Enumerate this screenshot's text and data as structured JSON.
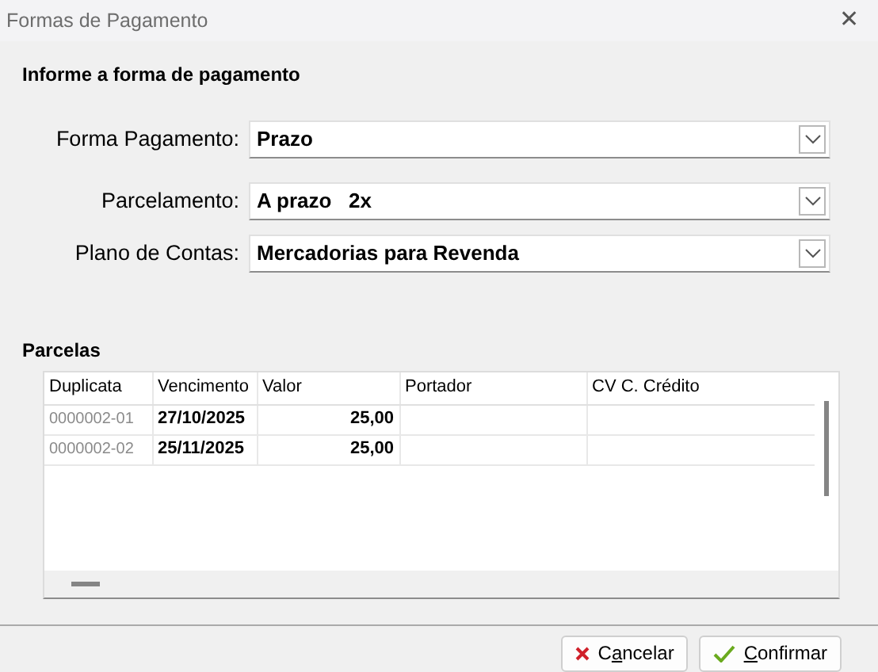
{
  "window": {
    "title": "Formas de Pagamento",
    "close": "✕"
  },
  "heading": "Informe a forma de pagamento",
  "fields": [
    {
      "label": "Forma Pagamento:",
      "value": "Prazo"
    },
    {
      "label": "Parcelamento:",
      "value": "A prazo   2x"
    },
    {
      "label": "Plano de Contas:",
      "value": "Mercadorias para Revenda"
    }
  ],
  "parcelas": {
    "title": "Parcelas",
    "columns": [
      "Duplicata",
      "Vencimento",
      "Valor",
      "Portador",
      "CV C. Crédito"
    ],
    "rows": [
      [
        "0000002-01",
        "27/10/2025",
        "25,00",
        "",
        ""
      ],
      [
        "0000002-02",
        "25/11/2025",
        "25,00",
        "",
        ""
      ]
    ]
  },
  "buttons": [
    {
      "kind": "cancel",
      "before": "C",
      "key": "a",
      "after": "ncelar"
    },
    {
      "kind": "confirm",
      "key": "C",
      "after": "onfirmar"
    }
  ]
}
